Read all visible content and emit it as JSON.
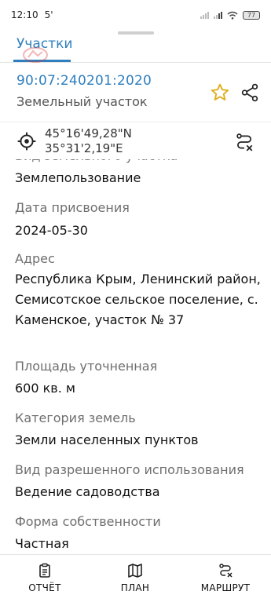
{
  "status_bar": {
    "time": "12:10",
    "indicator": "5'",
    "battery": "77",
    "icons": [
      "signal-icon",
      "signal-icon",
      "wifi-icon",
      "battery-icon"
    ]
  },
  "tabs": [
    {
      "label": "Участки",
      "active": true
    }
  ],
  "parcel": {
    "cadastral_number": "90:07:240201:2020",
    "type": "Земельный участок"
  },
  "coordinates": {
    "lat": "45°16'49,28\"N",
    "lon": "35°31'2,19\"E"
  },
  "details": [
    {
      "label": "Вид земельного участка",
      "value": "Землепользование"
    },
    {
      "label": "Дата присвоения",
      "value": "2024-05-30"
    },
    {
      "label": "Адрес",
      "value": "Республика Крым, Ленинский район, Семисотское сельское поселение, с. Каменское, участок № 37"
    },
    {
      "label": "Площадь уточненная",
      "value": "600 кв. м"
    },
    {
      "label": "Категория земель",
      "value": "Земли населенных пунктов"
    },
    {
      "label": "Вид разрешенного использования",
      "value": "Ведение садоводства"
    },
    {
      "label": "Форма собственности",
      "value": "Частная"
    }
  ],
  "bottom_nav": [
    {
      "label": "ОТЧЁТ",
      "icon": "report-icon"
    },
    {
      "label": "ПЛАН",
      "icon": "map-icon"
    },
    {
      "label": "МАРШРУТ",
      "icon": "route-icon"
    }
  ],
  "colors": {
    "accent": "#2f7fbe",
    "star": "#f2c230"
  }
}
